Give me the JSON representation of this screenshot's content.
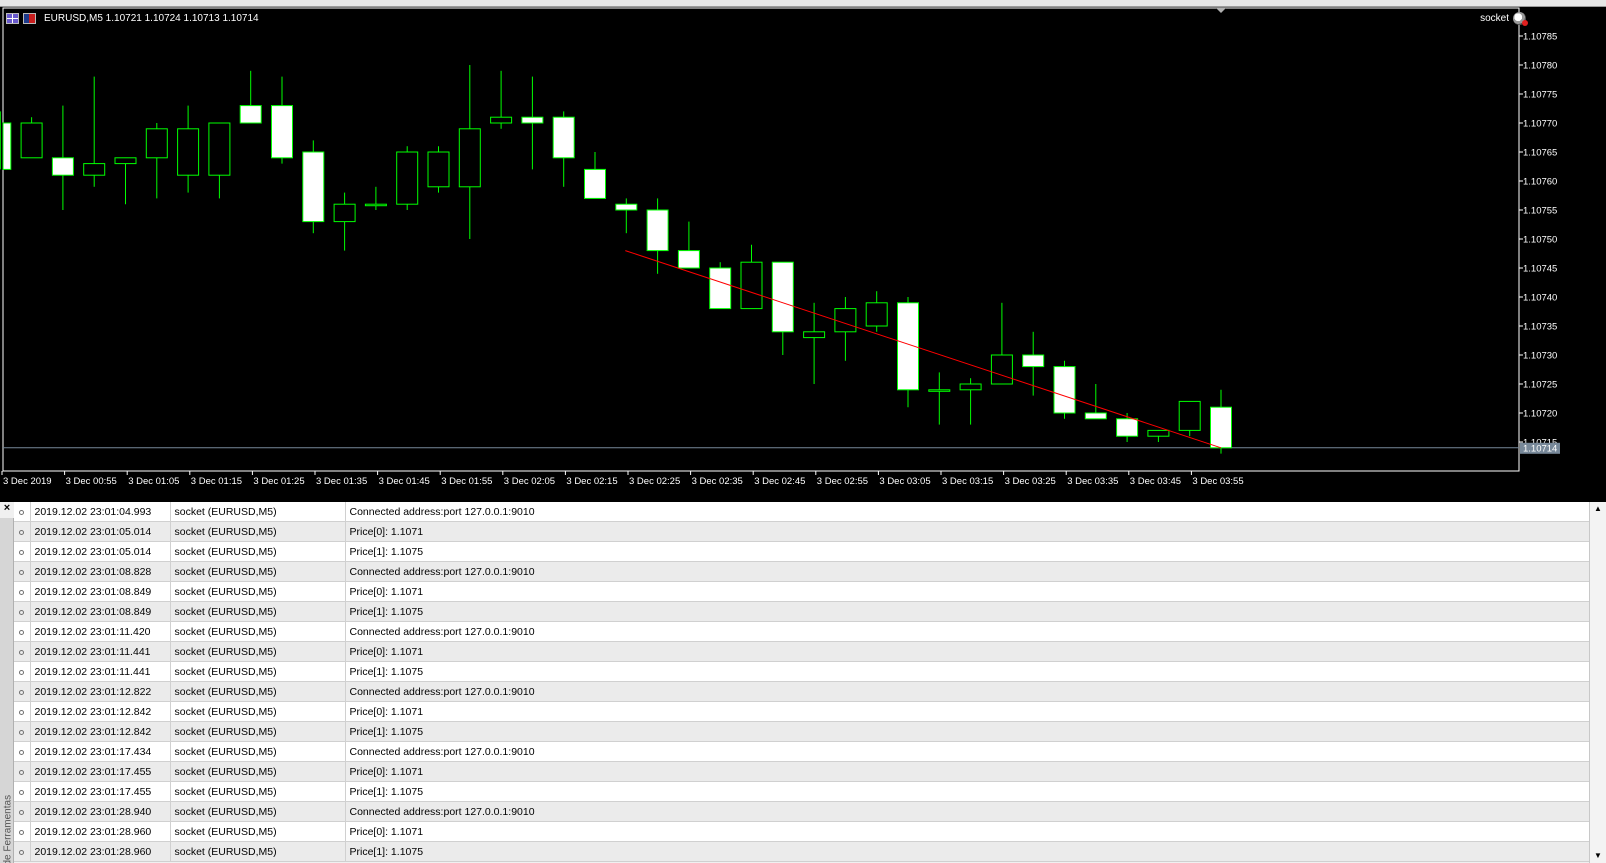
{
  "chart": {
    "symbol_info": "EURUSD,M5  1.10721 1.10724 1.10713 1.10714",
    "ea_name": "socket",
    "price_labels": [
      "1.10785",
      "1.10780",
      "1.10775",
      "1.10770",
      "1.10765",
      "1.10760",
      "1.10755",
      "1.10750",
      "1.10745",
      "1.10740",
      "1.10735",
      "1.10730",
      "1.10725",
      "1.10720",
      "1.10715"
    ],
    "current_price_label": "1.10714",
    "time_labels": [
      "3 Dec 2019",
      "3 Dec 00:55",
      "3 Dec 01:05",
      "3 Dec 01:15",
      "3 Dec 01:25",
      "3 Dec 01:35",
      "3 Dec 01:45",
      "3 Dec 01:55",
      "3 Dec 02:05",
      "3 Dec 02:15",
      "3 Dec 02:25",
      "3 Dec 02:35",
      "3 Dec 02:45",
      "3 Dec 02:55",
      "3 Dec 03:05",
      "3 Dec 03:15",
      "3 Dec 03:25",
      "3 Dec 03:35",
      "3 Dec 03:45",
      "3 Dec 03:55"
    ],
    "colors": {
      "background": "#000000",
      "candle_outline": "#00ff00",
      "bull_fill": "#000000",
      "bear_fill": "#ffffff",
      "trendline": "#ff0000",
      "bid_line": "#778899"
    }
  },
  "chart_data": {
    "type": "candlestick",
    "candles": [
      {
        "o": 1.1077,
        "h": 1.10772,
        "l": 1.10762,
        "c": 1.10762
      },
      {
        "o": 1.10764,
        "h": 1.10771,
        "l": 1.10764,
        "c": 1.1077
      },
      {
        "o": 1.10764,
        "h": 1.10773,
        "l": 1.10755,
        "c": 1.10761
      },
      {
        "o": 1.10761,
        "h": 1.10778,
        "l": 1.10759,
        "c": 1.10763
      },
      {
        "o": 1.10763,
        "h": 1.10764,
        "l": 1.10756,
        "c": 1.10764
      },
      {
        "o": 1.10764,
        "h": 1.1077,
        "l": 1.10757,
        "c": 1.10769
      },
      {
        "o": 1.10761,
        "h": 1.10773,
        "l": 1.10758,
        "c": 1.10769
      },
      {
        "o": 1.10761,
        "h": 1.1077,
        "l": 1.10757,
        "c": 1.1077
      },
      {
        "o": 1.10773,
        "h": 1.10779,
        "l": 1.1077,
        "c": 1.1077
      },
      {
        "o": 1.10773,
        "h": 1.10778,
        "l": 1.10763,
        "c": 1.10764
      },
      {
        "o": 1.10765,
        "h": 1.10767,
        "l": 1.10751,
        "c": 1.10753
      },
      {
        "o": 1.10753,
        "h": 1.10758,
        "l": 1.10748,
        "c": 1.10756
      },
      {
        "o": 1.10756,
        "h": 1.10759,
        "l": 1.10755,
        "c": 1.10756
      },
      {
        "o": 1.10756,
        "h": 1.10766,
        "l": 1.10755,
        "c": 1.10765
      },
      {
        "o": 1.10759,
        "h": 1.10766,
        "l": 1.10758,
        "c": 1.10765
      },
      {
        "o": 1.10759,
        "h": 1.1078,
        "l": 1.1075,
        "c": 1.10769
      },
      {
        "o": 1.1077,
        "h": 1.10779,
        "l": 1.10769,
        "c": 1.10771
      },
      {
        "o": 1.10771,
        "h": 1.10778,
        "l": 1.10762,
        "c": 1.1077
      },
      {
        "o": 1.10771,
        "h": 1.10772,
        "l": 1.10759,
        "c": 1.10764
      },
      {
        "o": 1.10762,
        "h": 1.10765,
        "l": 1.10757,
        "c": 1.10757
      },
      {
        "o": 1.10756,
        "h": 1.10757,
        "l": 1.10751,
        "c": 1.10755
      },
      {
        "o": 1.10755,
        "h": 1.10757,
        "l": 1.10744,
        "c": 1.10748
      },
      {
        "o": 1.10748,
        "h": 1.10753,
        "l": 1.10745,
        "c": 1.10745
      },
      {
        "o": 1.10745,
        "h": 1.10746,
        "l": 1.10738,
        "c": 1.10738
      },
      {
        "o": 1.10738,
        "h": 1.10749,
        "l": 1.10738,
        "c": 1.10746
      },
      {
        "o": 1.10746,
        "h": 1.10746,
        "l": 1.1073,
        "c": 1.10734
      },
      {
        "o": 1.10733,
        "h": 1.10739,
        "l": 1.10725,
        "c": 1.10734
      },
      {
        "o": 1.10734,
        "h": 1.1074,
        "l": 1.10729,
        "c": 1.10738
      },
      {
        "o": 1.10735,
        "h": 1.10741,
        "l": 1.10734,
        "c": 1.10739
      },
      {
        "o": 1.10739,
        "h": 1.1074,
        "l": 1.10721,
        "c": 1.10724
      },
      {
        "o": 1.10724,
        "h": 1.10727,
        "l": 1.10718,
        "c": 1.10724
      },
      {
        "o": 1.10724,
        "h": 1.10726,
        "l": 1.10718,
        "c": 1.10725
      },
      {
        "o": 1.10725,
        "h": 1.10739,
        "l": 1.10725,
        "c": 1.1073
      },
      {
        "o": 1.1073,
        "h": 1.10734,
        "l": 1.10723,
        "c": 1.10728
      },
      {
        "o": 1.10728,
        "h": 1.10729,
        "l": 1.10719,
        "c": 1.1072
      },
      {
        "o": 1.1072,
        "h": 1.10725,
        "l": 1.10719,
        "c": 1.10719
      },
      {
        "o": 1.10719,
        "h": 1.1072,
        "l": 1.10715,
        "c": 1.10716
      },
      {
        "o": 1.10716,
        "h": 1.10717,
        "l": 1.10715,
        "c": 1.10717
      },
      {
        "o": 1.10717,
        "h": 1.10722,
        "l": 1.10716,
        "c": 1.10722
      },
      {
        "o": 1.10721,
        "h": 1.10724,
        "l": 1.10713,
        "c": 1.10714
      }
    ],
    "trendline": {
      "from": {
        "bar": 20,
        "price": 1.10748
      },
      "to": {
        "bar": 39,
        "price": 1.10714
      }
    },
    "ylim": [
      1.1071,
      1.1079
    ]
  },
  "log": {
    "rows": [
      {
        "time": "2019.12.02 23:01:04.993",
        "source": "socket (EURUSD,M5)",
        "message": "Connected address:port 127.0.0.1:9010"
      },
      {
        "time": "2019.12.02 23:01:05.014",
        "source": "socket (EURUSD,M5)",
        "message": "Price[0]: 1.1071"
      },
      {
        "time": "2019.12.02 23:01:05.014",
        "source": "socket (EURUSD,M5)",
        "message": "Price[1]: 1.1075"
      },
      {
        "time": "2019.12.02 23:01:08.828",
        "source": "socket (EURUSD,M5)",
        "message": "Connected address:port 127.0.0.1:9010"
      },
      {
        "time": "2019.12.02 23:01:08.849",
        "source": "socket (EURUSD,M5)",
        "message": "Price[0]: 1.1071"
      },
      {
        "time": "2019.12.02 23:01:08.849",
        "source": "socket (EURUSD,M5)",
        "message": "Price[1]: 1.1075"
      },
      {
        "time": "2019.12.02 23:01:11.420",
        "source": "socket (EURUSD,M5)",
        "message": "Connected address:port 127.0.0.1:9010"
      },
      {
        "time": "2019.12.02 23:01:11.441",
        "source": "socket (EURUSD,M5)",
        "message": "Price[0]: 1.1071"
      },
      {
        "time": "2019.12.02 23:01:11.441",
        "source": "socket (EURUSD,M5)",
        "message": "Price[1]: 1.1075"
      },
      {
        "time": "2019.12.02 23:01:12.822",
        "source": "socket (EURUSD,M5)",
        "message": "Connected address:port 127.0.0.1:9010"
      },
      {
        "time": "2019.12.02 23:01:12.842",
        "source": "socket (EURUSD,M5)",
        "message": "Price[0]: 1.1071"
      },
      {
        "time": "2019.12.02 23:01:12.842",
        "source": "socket (EURUSD,M5)",
        "message": "Price[1]: 1.1075"
      },
      {
        "time": "2019.12.02 23:01:17.434",
        "source": "socket (EURUSD,M5)",
        "message": "Connected address:port 127.0.0.1:9010"
      },
      {
        "time": "2019.12.02 23:01:17.455",
        "source": "socket (EURUSD,M5)",
        "message": "Price[0]: 1.1071"
      },
      {
        "time": "2019.12.02 23:01:17.455",
        "source": "socket (EURUSD,M5)",
        "message": "Price[1]: 1.1075"
      },
      {
        "time": "2019.12.02 23:01:28.940",
        "source": "socket (EURUSD,M5)",
        "message": "Connected address:port 127.0.0.1:9010"
      },
      {
        "time": "2019.12.02 23:01:28.960",
        "source": "socket (EURUSD,M5)",
        "message": "Price[0]: 1.1071"
      },
      {
        "time": "2019.12.02 23:01:28.960",
        "source": "socket (EURUSD,M5)",
        "message": "Price[1]: 1.1075"
      }
    ]
  },
  "toolbox": {
    "close_glyph": "×",
    "panel_label": "de Ferramentas",
    "scroll_up_glyph": "▲",
    "scroll_down_glyph": "▼",
    "row_icon": "info-dot-icon"
  }
}
